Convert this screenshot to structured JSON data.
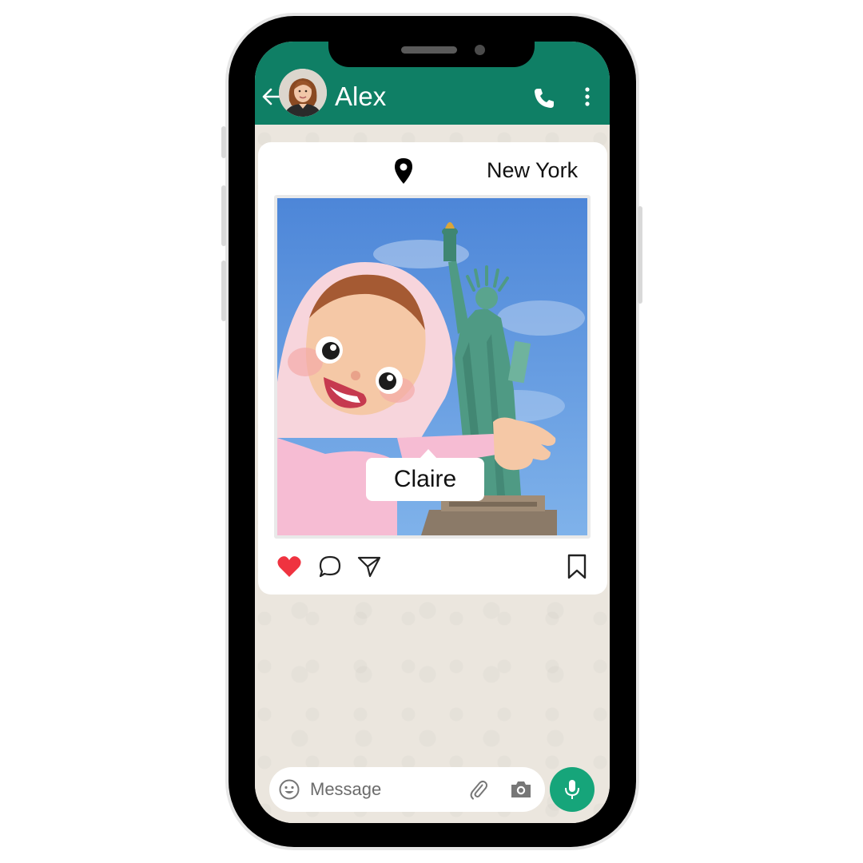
{
  "header": {
    "contact_name": "Alex",
    "icons": [
      "back-arrow-icon",
      "avatar",
      "phone-icon",
      "more-vert-icon"
    ],
    "color": "#0f7f65"
  },
  "post": {
    "location": "New York",
    "tag": "Claire",
    "liked": true,
    "icons": [
      "location-pin-icon",
      "heart-icon",
      "comment-icon",
      "share-icon",
      "bookmark-icon"
    ]
  },
  "composer": {
    "placeholder": "Message",
    "icons": [
      "emoji-icon",
      "attach-icon",
      "camera-icon",
      "mic-icon"
    ],
    "mic_color": "#16a57a"
  }
}
